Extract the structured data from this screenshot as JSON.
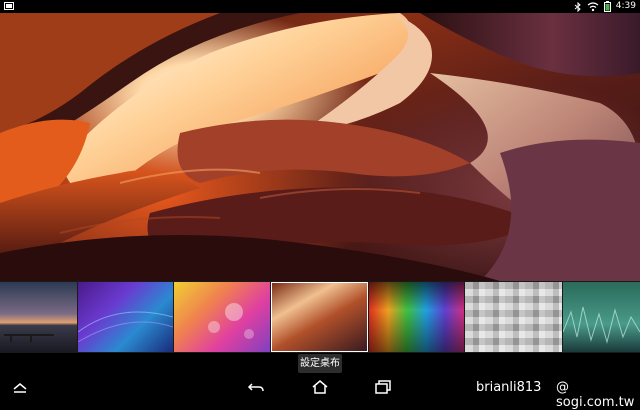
{
  "status": {
    "time": "4:39",
    "icons": [
      "screenshot-icon",
      "bluetooth-icon",
      "wifi-icon",
      "battery-icon"
    ]
  },
  "wallpaper_picker": {
    "thumbnails": [
      {
        "name": "thumb-sunset-pier"
      },
      {
        "name": "thumb-blue-waves"
      },
      {
        "name": "thumb-pink-bokeh"
      },
      {
        "name": "thumb-antelope-canyon",
        "selected": true
      },
      {
        "name": "thumb-color-bars"
      },
      {
        "name": "thumb-gray-mosaic"
      },
      {
        "name": "thumb-green-lines"
      }
    ],
    "set_wallpaper_label": "設定桌布"
  },
  "navigation": {
    "icons": [
      "menu-up-icon",
      "back-icon",
      "home-icon",
      "recent-apps-icon"
    ]
  },
  "watermark": {
    "user": "brianli813",
    "site": "@ sogi.com.tw"
  }
}
